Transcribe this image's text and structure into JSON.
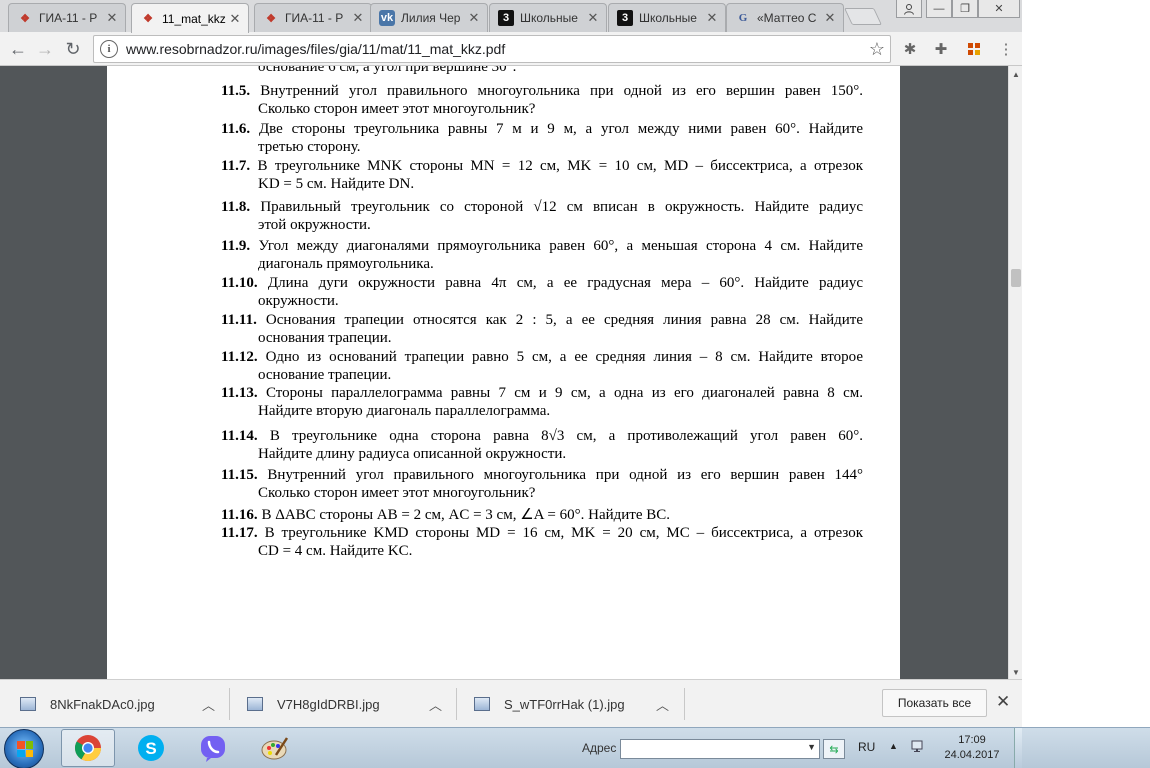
{
  "tabs": [
    {
      "title": "ГИА-11 - Р",
      "icon": "gia-icon",
      "active": false
    },
    {
      "title": "11_mat_kkz",
      "icon": "gia-icon",
      "active": true
    },
    {
      "title": "ГИА-11 - Р",
      "icon": "gia-icon",
      "active": false
    },
    {
      "title": "Лилия Чер",
      "icon": "vk-icon",
      "active": false
    },
    {
      "title": "Школьные",
      "icon": "znanija-icon",
      "active": false
    },
    {
      "title": "Школьные",
      "icon": "znanija-icon",
      "active": false
    },
    {
      "title": "«Маттео С",
      "icon": "google-icon",
      "active": false
    }
  ],
  "toolbar": {
    "url": "www.resobrnadzor.ru/images/files/gia/11/mat/11_mat_kkz.pdf"
  },
  "pdf": {
    "cut_top_text": "основание 6 см, а угол при вершине 30°.",
    "problems": [
      {
        "num": "11.5.",
        "line1": "Внутренний угол правильного многоугольника при одной из его вершин равен 150°.",
        "line2": "Сколько сторон имеет этот многоугольник?"
      },
      {
        "num": "11.6.",
        "line1": "Две стороны треугольника равны 7 м и 9 м, а угол между ними равен 60°. Найдите",
        "line2": "третью сторону."
      },
      {
        "num": "11.7.",
        "line1": "В треугольнике MNK стороны MN = 12 см, MK = 10 см, MD – биссектриса, а отрезок",
        "line2": "KD = 5 см. Найдите DN."
      },
      {
        "num": "11.8.",
        "line1": "Правильный треугольник со стороной √12 см вписан в окружность. Найдите радиус",
        "line2": "этой окружности."
      },
      {
        "num": "11.9.",
        "line1": "Угол между диагоналями прямоугольника равен 60°, а меньшая сторона 4 см. Найдите",
        "line2": "диагональ прямоугольника."
      },
      {
        "num": "11.10.",
        "line1": "Длина дуги окружности равна 4π см, а ее градусная мера – 60°. Найдите радиус",
        "line2": "окружности."
      },
      {
        "num": "11.11.",
        "line1": "Основания трапеции относятся как 2 : 5, а ее средняя линия равна 28 см. Найдите",
        "line2": "основания трапеции."
      },
      {
        "num": "11.12.",
        "line1": "Одно из оснований трапеции равно 5 см, а ее средняя линия – 8 см. Найдите второе",
        "line2": "основание трапеции."
      },
      {
        "num": "11.13.",
        "line1": "Стороны параллелограмма равны 7 см и 9 см, а одна из его диагоналей равна 8 см.",
        "line2": "Найдите вторую диагональ параллелограмма."
      },
      {
        "num": "11.14.",
        "line1": "В треугольнике одна сторона равна 8√3 см, а противолежащий угол равен 60°.",
        "line2": "Найдите длину радиуса описанной окружности."
      },
      {
        "num": "11.15.",
        "line1": "Внутренний угол правильного многоугольника при одной из его вершин равен 144°",
        "line2": "Сколько сторон имеет этот многоугольник?"
      },
      {
        "num": "11.16.",
        "line1": "В ΔABC стороны AB = 2 см, AC = 3 см, ∠A = 60°. Найдите BC.",
        "line2": ""
      },
      {
        "num": "11.17.",
        "line1": "В треугольнике KMD стороны MD = 16 см, MK = 20 см, MC – биссектриса, а отрезок",
        "line2": "CD = 4 см. Найдите KC."
      }
    ]
  },
  "downloads": {
    "items": [
      {
        "name": "8NkFnakDAc0.jpg"
      },
      {
        "name": "V7H8gIdDRBI.jpg"
      },
      {
        "name": "S_wTF0rrHak (1).jpg"
      }
    ],
    "show_all": "Показать все"
  },
  "taskbar": {
    "address_label": "Адрес",
    "language": "RU",
    "time": "17:09",
    "date": "24.04.2017"
  }
}
